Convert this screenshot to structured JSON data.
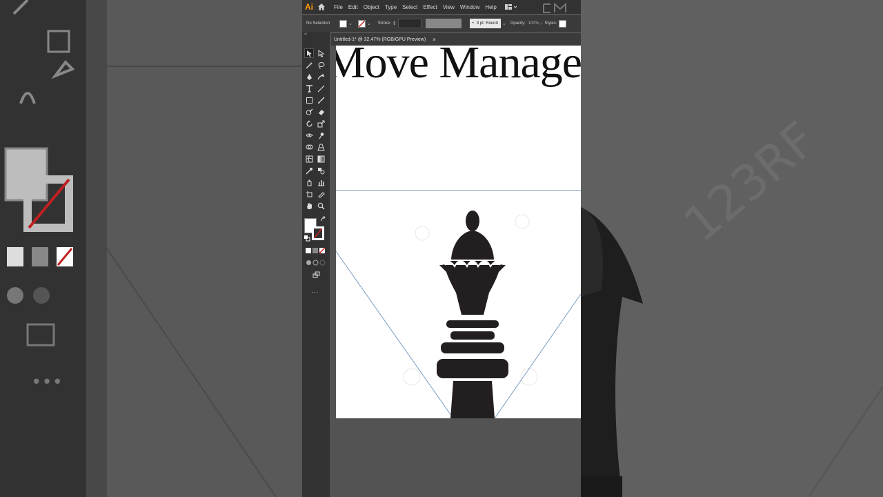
{
  "app": {
    "logo": "Ai",
    "menu": [
      "File",
      "Edit",
      "Object",
      "Type",
      "Select",
      "Effect",
      "View",
      "Window",
      "Help"
    ]
  },
  "control_bar": {
    "selection": "No Selection",
    "stroke_label": "Stroke:",
    "brush": "3 pt. Round",
    "opacity_label": "Opacity:",
    "opacity_value": "100%",
    "styles_label": "Styles:"
  },
  "document": {
    "tab_title": "Untitled-1* @ 32.47% (RGB/GPU Preview)",
    "close_glyph": "×"
  },
  "artboard": {
    "headline_text": "Move Management"
  },
  "toolbox": {
    "collapse_glyph": "«",
    "more_glyph": "..."
  },
  "colors": {
    "accent": "#ff9a00",
    "chrome_dark": "#323232",
    "canvas": "#535353",
    "artwork": "#231f20"
  }
}
